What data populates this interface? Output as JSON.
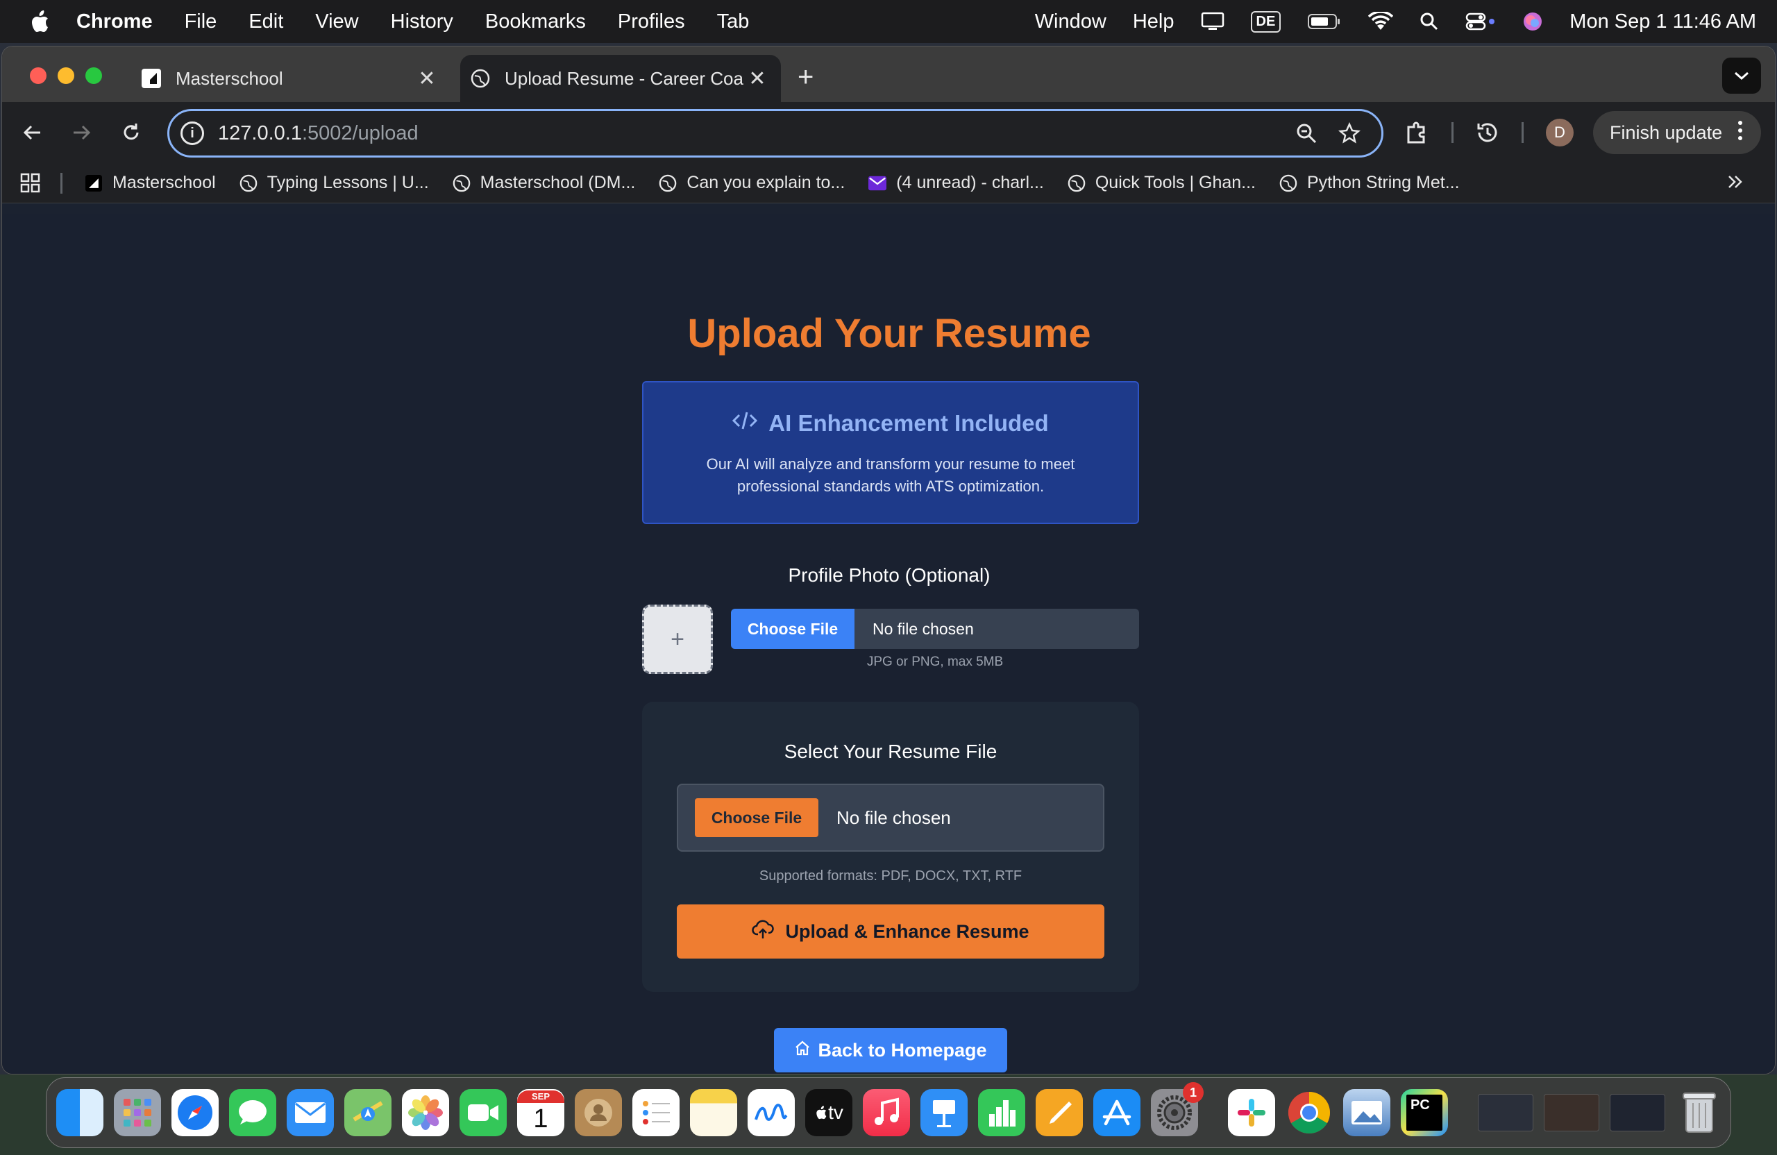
{
  "menubar": {
    "app_name": "Chrome",
    "items": [
      "File",
      "Edit",
      "View",
      "History",
      "Bookmarks",
      "Profiles",
      "Tab",
      "Window",
      "Help"
    ],
    "keyboard_layout": "DE",
    "datetime": "Mon Sep 1  11:46 AM"
  },
  "tabs": [
    {
      "title": "Masterschool",
      "active": false
    },
    {
      "title": "Upload Resume - Career Coach",
      "active": true
    }
  ],
  "address_bar": {
    "host": "127.0.0.1",
    "path": ":5002/upload"
  },
  "toolbar": {
    "profile_initial": "D",
    "finish_update_label": "Finish update"
  },
  "bookmarks": [
    {
      "label": "Masterschool",
      "icon": "masterschool-icon"
    },
    {
      "label": "Typing Lessons | U...",
      "icon": "globe-icon"
    },
    {
      "label": "Masterschool (DM...",
      "icon": "globe-icon"
    },
    {
      "label": "Can you explain to...",
      "icon": "globe-icon"
    },
    {
      "label": "(4 unread) - charl...",
      "icon": "mail-icon"
    },
    {
      "label": "Quick Tools | Ghan...",
      "icon": "globe-icon"
    },
    {
      "label": "Python String Met...",
      "icon": "globe-icon"
    }
  ],
  "page": {
    "title": "Upload Your Resume",
    "ai_box": {
      "title": "AI Enhancement Included",
      "description": "Our AI will analyze and transform your resume to meet professional standards with ATS optimization."
    },
    "photo": {
      "label": "Profile Photo (Optional)",
      "placeholder_symbol": "+",
      "choose_label": "Choose File",
      "status": "No file chosen",
      "hint": "JPG or PNG, max 5MB"
    },
    "resume": {
      "title": "Select Your Resume File",
      "choose_label": "Choose File",
      "status": "No file chosen",
      "hint": "Supported formats: PDF, DOCX, TXT, RTF",
      "upload_label": "Upload & Enhance Resume"
    },
    "home_label": "Back to Homepage"
  },
  "colors": {
    "accent_orange": "#ef7d31",
    "accent_blue": "#3b82f6",
    "ai_box_bg": "#1e3a8a",
    "page_bg": "#1a2130"
  },
  "dock": {
    "calendar_month": "SEP",
    "calendar_day": "1",
    "settings_badge": "1",
    "tv_label": "tv",
    "pycharm_label": "PC",
    "apps": [
      "finder-icon",
      "launchpad-icon",
      "safari-icon",
      "messages-icon",
      "mail-icon",
      "maps-icon",
      "photos-icon",
      "facetime-icon",
      "calendar-icon",
      "contacts-icon",
      "reminders-icon",
      "notes-icon",
      "freeform-icon",
      "tv-icon",
      "music-icon",
      "keynote-icon",
      "numbers-icon",
      "pages-icon",
      "app-store-icon",
      "system-settings-icon",
      "slack-icon",
      "chrome-icon",
      "preview-icon",
      "pycharm-icon",
      "trash-icon"
    ]
  }
}
